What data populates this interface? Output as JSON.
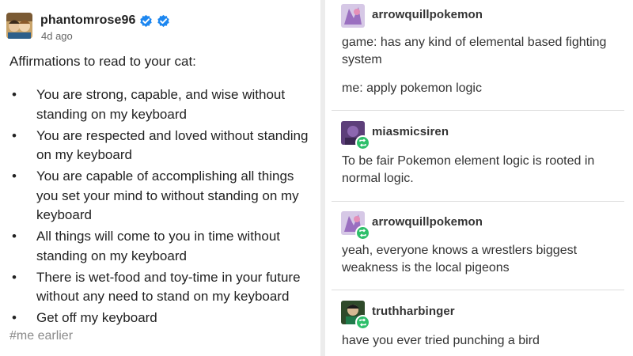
{
  "left_post": {
    "username": "phantomrose96",
    "time": "4d ago",
    "intro": "Affirmations to read to your cat:",
    "items": [
      "You are strong, capable, and wise without standing on my keyboard",
      "You are respected and loved without standing on my keyboard",
      "You are capable of accomplishing all things you set your mind to without standing on my keyboard",
      "All things will come to you in time without standing on my keyboard",
      "There is wet-food and toy-time in your future without any need to stand on my keyboard",
      "Get off my keyboard"
    ],
    "tag": "#me earlier"
  },
  "thread": [
    {
      "username": "arrowquillpokemon",
      "paragraphs": [
        "game: has any kind of elemental based fighting system",
        "me: apply pokemon logic"
      ]
    },
    {
      "username": "miasmicsiren",
      "paragraphs": [
        "To be fair Pokemon element logic is rooted in normal logic."
      ]
    },
    {
      "username": "arrowquillpokemon",
      "paragraphs": [
        "yeah, everyone knows a wrestlers biggest weakness is the local pigeons"
      ]
    },
    {
      "username": "truthharbinger",
      "paragraphs": [
        "have you ever tried punching a bird"
      ]
    }
  ],
  "colors": {
    "verified_blue": "#1d87f0",
    "reblog_green": "#2ebf6a"
  }
}
